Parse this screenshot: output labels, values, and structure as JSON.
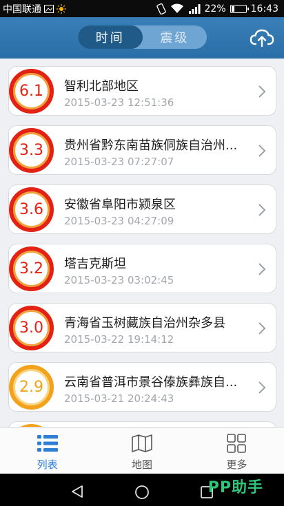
{
  "status": {
    "carrier": "中国联通",
    "battery": "22%",
    "time": "16:43",
    "battery_level": 0.22
  },
  "header": {
    "tab_time": "时间",
    "tab_magnitude": "震级"
  },
  "quakes": [
    {
      "mag": "6.1",
      "place": "智利北部地区",
      "time": "2015-03-23 12:51:36",
      "level": "red"
    },
    {
      "mag": "3.3",
      "place": "贵州省黔东南苗族侗族自治州...",
      "time": "2015-03-23 07:27:07",
      "level": "red"
    },
    {
      "mag": "3.6",
      "place": "安徽省阜阳市颍泉区",
      "time": "2015-03-23 04:27:09",
      "level": "red"
    },
    {
      "mag": "3.2",
      "place": "塔吉克斯坦",
      "time": "2015-03-23 03:02:45",
      "level": "red"
    },
    {
      "mag": "3.0",
      "place": "青海省玉树藏族自治州杂多县",
      "time": "2015-03-22 19:14:12",
      "level": "red"
    },
    {
      "mag": "2.9",
      "place": "云南省普洱市景谷傣族彝族自...",
      "time": "2015-03-21 20:24:43",
      "level": "orange"
    }
  ],
  "tabs": [
    {
      "label": "列表",
      "icon": "list-icon",
      "active": true
    },
    {
      "label": "地图",
      "icon": "map-icon",
      "active": false
    },
    {
      "label": "更多",
      "icon": "grid-icon",
      "active": false
    }
  ],
  "watermark": "PP助手",
  "colors": {
    "accent": "#2d7dd6",
    "header": "#2a6ea7",
    "red": "#e32214",
    "orange": "#f3a21c"
  }
}
